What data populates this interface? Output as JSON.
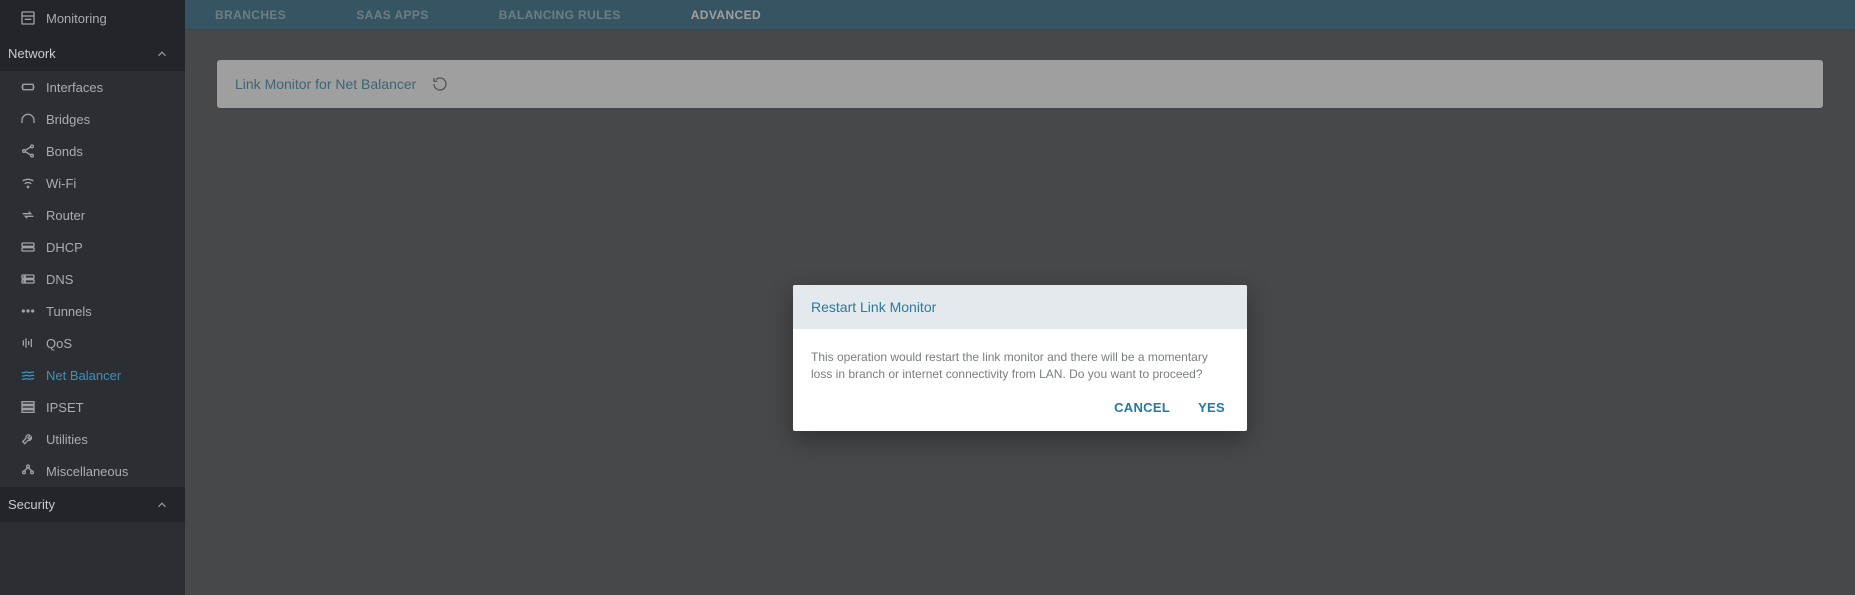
{
  "sidebar": {
    "top": {
      "label": "Monitoring"
    },
    "sections": [
      {
        "title": "Network",
        "items": [
          {
            "label": "Interfaces",
            "icon": "interfaces-icon",
            "active": false
          },
          {
            "label": "Bridges",
            "icon": "bridges-icon",
            "active": false
          },
          {
            "label": "Bonds",
            "icon": "bonds-icon",
            "active": false
          },
          {
            "label": "Wi-Fi",
            "icon": "wifi-icon",
            "active": false
          },
          {
            "label": "Router",
            "icon": "router-icon",
            "active": false
          },
          {
            "label": "DHCP",
            "icon": "dhcp-icon",
            "active": false
          },
          {
            "label": "DNS",
            "icon": "dns-icon",
            "active": false
          },
          {
            "label": "Tunnels",
            "icon": "tunnels-icon",
            "active": false
          },
          {
            "label": "QoS",
            "icon": "qos-icon",
            "active": false
          },
          {
            "label": "Net Balancer",
            "icon": "netbalancer-icon",
            "active": true
          },
          {
            "label": "IPSET",
            "icon": "ipset-icon",
            "active": false
          },
          {
            "label": "Utilities",
            "icon": "utilities-icon",
            "active": false
          },
          {
            "label": "Miscellaneous",
            "icon": "misc-icon",
            "active": false
          }
        ]
      },
      {
        "title": "Security",
        "items": []
      }
    ]
  },
  "topbar": {
    "tabs": [
      {
        "label": "BRANCHES",
        "active": false
      },
      {
        "label": "SAAS APPS",
        "active": false
      },
      {
        "label": "BALANCING RULES",
        "active": false
      },
      {
        "label": "ADVANCED",
        "active": true
      }
    ]
  },
  "main": {
    "card_title": "Link Monitor for Net Balancer"
  },
  "dialog": {
    "title": "Restart Link Monitor",
    "body": "This operation would restart the link monitor and there will be a momentary loss in branch or internet connectivity from LAN. Do you want to proceed?",
    "cancel": "CANCEL",
    "yes": "YES"
  }
}
